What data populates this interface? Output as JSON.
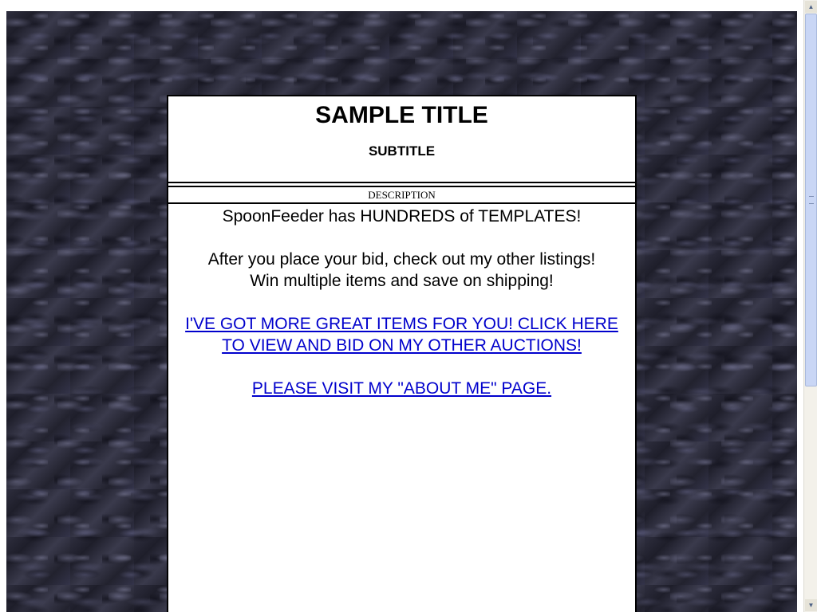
{
  "page": {
    "title": "SAMPLE TITLE",
    "subtitle": "SUBTITLE",
    "description_header": "DESCRIPTION"
  },
  "body": {
    "line1": "SpoonFeeder has HUNDREDS of TEMPLATES!",
    "line2": "After you place your bid, check out my other listings!",
    "line3": "Win multiple items and save on shipping!",
    "link_other_auctions": "I'VE GOT MORE GREAT ITEMS FOR YOU! CLICK HERE TO VIEW AND BID ON MY OTHER AUCTIONS!",
    "link_about_me": "PLEASE VISIT MY \"ABOUT ME\" PAGE."
  },
  "scrollbar": {
    "up_icon": "arrow-up-icon",
    "down_icon": "arrow-down-icon"
  },
  "colors": {
    "link": "#0000cc",
    "background_pattern": "#2a2a38",
    "panel_border": "#000000"
  }
}
